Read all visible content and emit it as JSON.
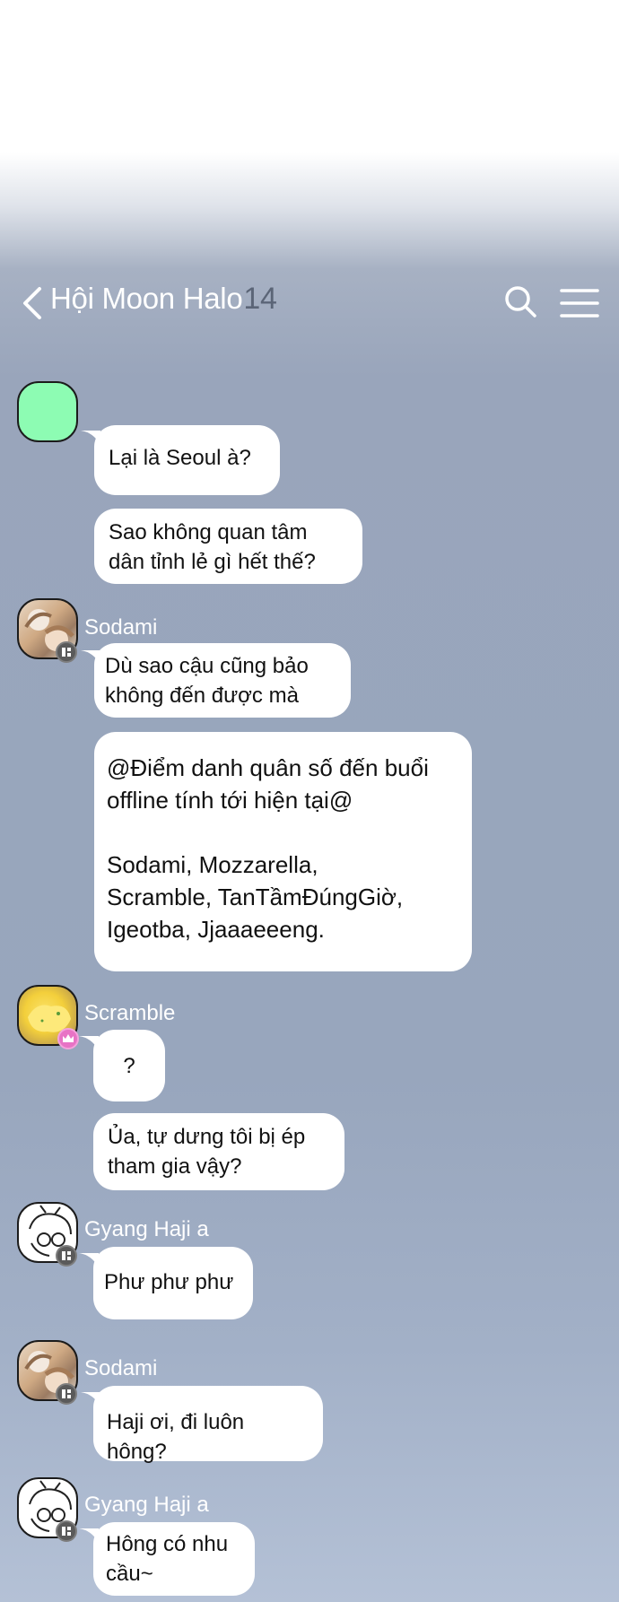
{
  "header": {
    "title": "Hội Moon Halo",
    "member_count": "14",
    "back_icon": "chevron-left-icon",
    "search_icon": "search-icon",
    "menu_icon": "menu-icon"
  },
  "colors": {
    "background_top": "#ffffff",
    "background_chat": "#98a6bd",
    "bubble": "#ffffff",
    "green_avatar": "#8dfcb3",
    "header_count": "#5b6577",
    "crown_badge": "#e873c5"
  },
  "messages": [
    {
      "sender": "",
      "text": "Lại là Seoul à?"
    },
    {
      "sender": "",
      "text": "Sao không quan tâm\ndân tỉnh lẻ gì hết thế?"
    },
    {
      "sender": "Sodami",
      "text": "Dù sao cậu cũng bảo\nkhông đến được mà"
    },
    {
      "sender": "Sodami",
      "text": "@Điểm danh quân số đến buổi\noffline tính tới hiện tại@\n\n   Sodami, Mozzarella,\nScramble, TanTầmĐúngGiờ,\nIgeotba, Jjaaaeeeng."
    },
    {
      "sender": "Scramble",
      "text": "?"
    },
    {
      "sender": "Scramble",
      "text": "Ủa, tự dưng tôi bị ép\ntham gia vậy?"
    },
    {
      "sender": "Gyang Haji a",
      "text": "Phư phư phư"
    },
    {
      "sender": "Sodami",
      "text": "Haji ơi, đi luôn hông?"
    },
    {
      "sender": "Gyang Haji a",
      "text": "Hông có nhu\ncầu~"
    }
  ],
  "names": {
    "sodami_1": "Sodami",
    "scramble": "Scramble",
    "haji_1": "Gyang Haji a",
    "sodami_2": "Sodami",
    "haji_2": "Gyang Haji a"
  }
}
